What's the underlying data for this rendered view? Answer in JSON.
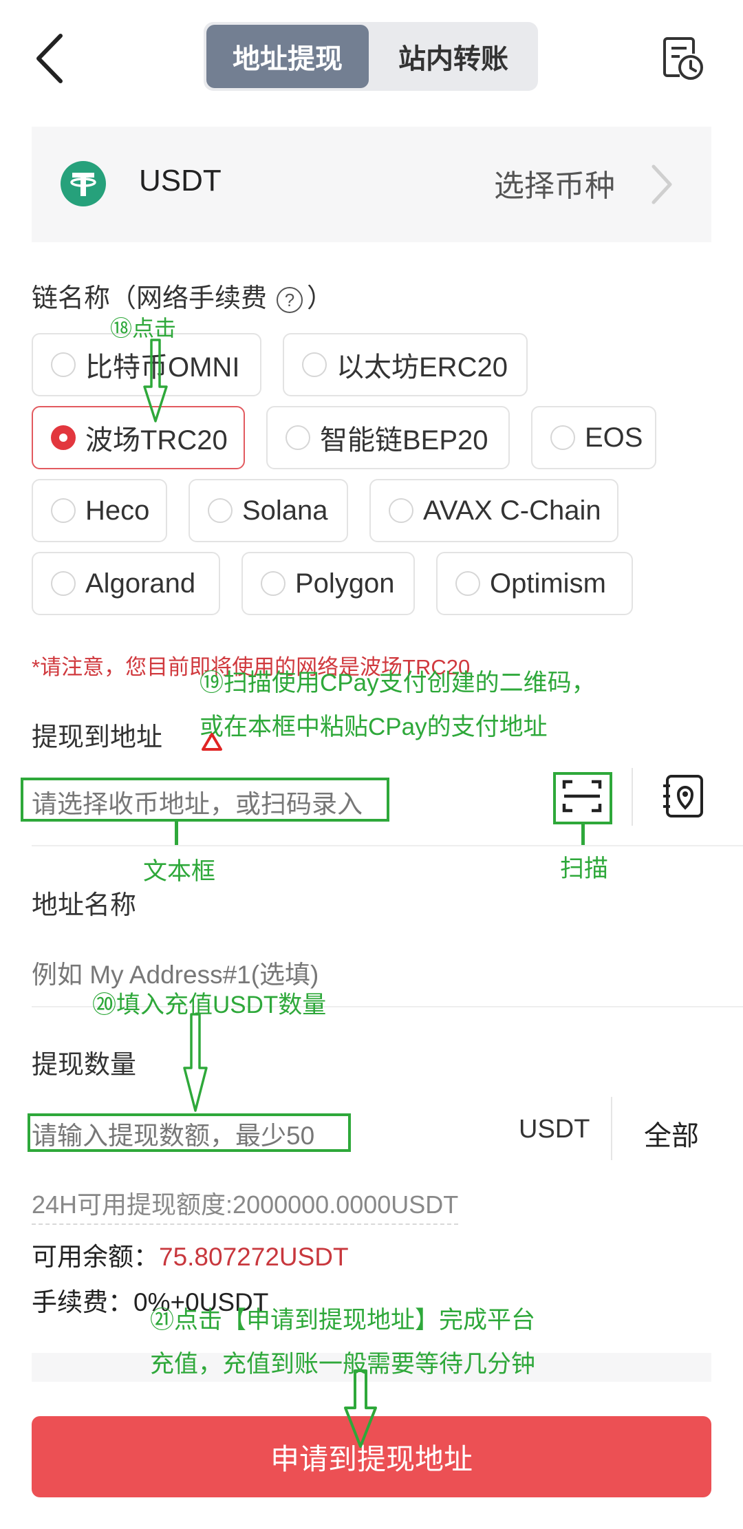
{
  "header": {
    "tabs": [
      {
        "label": "地址提现",
        "active": true
      },
      {
        "label": "站内转账",
        "active": false
      }
    ],
    "back_icon": "chevron-left-icon",
    "history_icon": "history-record-icon"
  },
  "coin": {
    "symbol": "USDT",
    "select_label": "选择币种",
    "logo_icon": "tether-logo-icon",
    "logo_color": "#26a17b"
  },
  "network": {
    "label": "链名称（网络手续费",
    "label_end": "）",
    "help_glyph": "?",
    "options": [
      {
        "label": "比特币OMNI",
        "selected": false
      },
      {
        "label": "以太坊ERC20",
        "selected": false
      },
      {
        "label": "波场TRC20",
        "selected": true
      },
      {
        "label": "智能链BEP20",
        "selected": false
      },
      {
        "label": "EOS",
        "selected": false
      },
      {
        "label": "Heco",
        "selected": false
      },
      {
        "label": "Solana",
        "selected": false
      },
      {
        "label": "AVAX C-Chain",
        "selected": false
      },
      {
        "label": "Algorand",
        "selected": false
      },
      {
        "label": "Polygon",
        "selected": false
      },
      {
        "label": "Optimism",
        "selected": false
      }
    ],
    "notice": "*请注意，您目前即将使用的网络是波场TRC20"
  },
  "address": {
    "label": "提现到地址",
    "placeholder": "请选择收币地址，或扫码录入",
    "scan_icon": "scan-icon",
    "address_book_icon": "address-book-icon"
  },
  "address_name": {
    "label": "地址名称",
    "placeholder": "例如 My Address#1(选填)"
  },
  "amount": {
    "label": "提现数量",
    "placeholder": "请输入提现数额，最少50",
    "unit": "USDT",
    "all_label": "全部",
    "limit_text": "24H可用提现额度:2000000.0000USDT",
    "balance_label": "可用余额：",
    "balance_value": "75.807272USDT",
    "fee_text": "手续费：0%+0USDT"
  },
  "submit": {
    "label": "申请到提现地址",
    "color": "#ec5054"
  },
  "annotations": {
    "step18": "⑱点击",
    "step19_line1": "⑲扫描使用CPay支付创建的二维码，",
    "step19_line2": "或在本框中粘贴CPay的支付地址",
    "textbox": "文本框",
    "scan": "扫描",
    "step20": "⑳填入充值USDT数量",
    "step21_line1": "㉑点击【申请到提现地址】完成平台",
    "step21_line2": "充值，充值到账一般需要等待几分钟",
    "color": "#2ea83a"
  }
}
